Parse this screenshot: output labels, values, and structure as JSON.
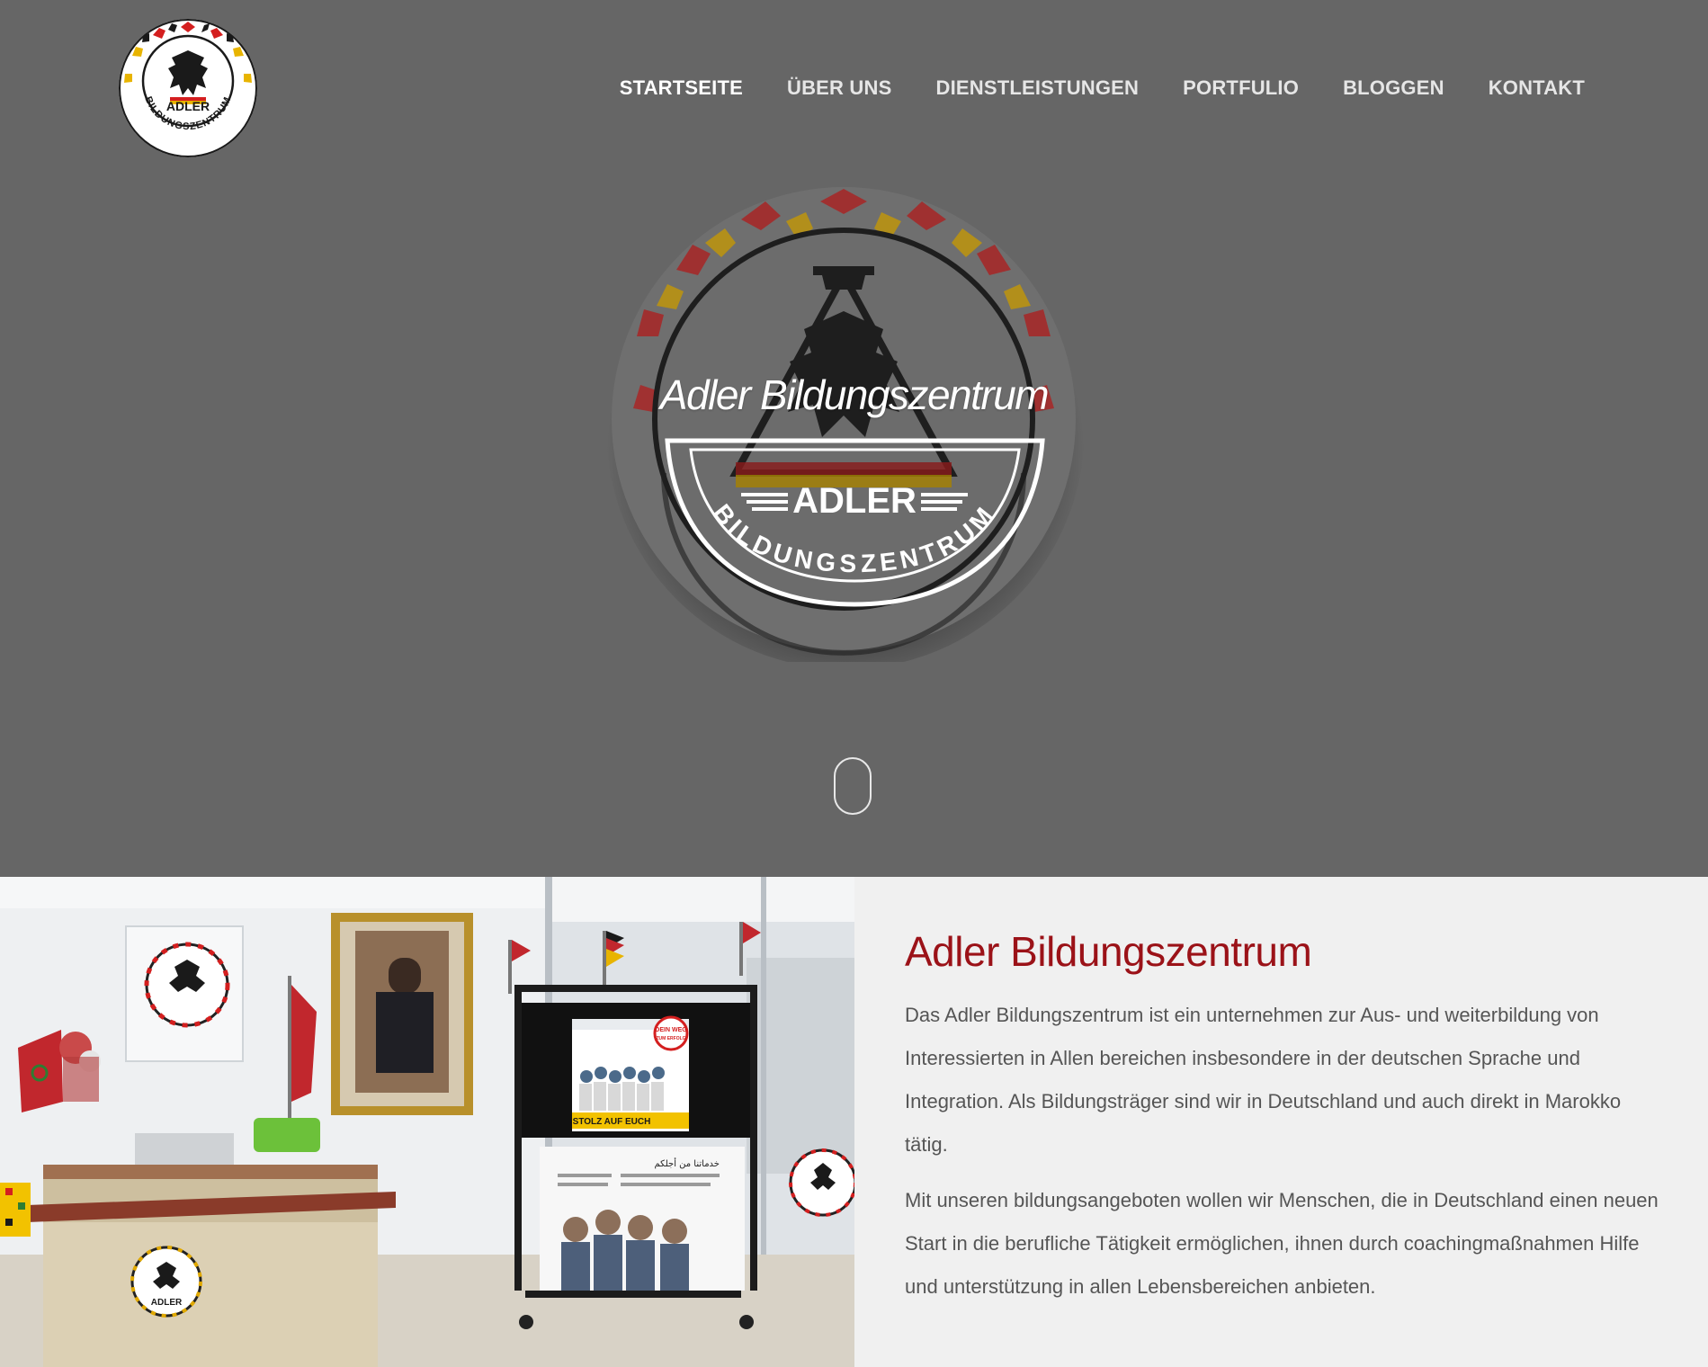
{
  "header": {
    "logo_alt": "Adler Bildungszentrum Logo",
    "logo_text_top": "ADLER",
    "logo_text_ring": "BILDUNGSZENTRUM"
  },
  "nav": {
    "items": [
      {
        "label": "STARTSEITE",
        "active": true
      },
      {
        "label": "ÜBER UNS",
        "active": false
      },
      {
        "label": "DIENSTLEISTUNGEN",
        "active": false
      },
      {
        "label": "PORTFULIO",
        "active": false
      },
      {
        "label": "BLOGGEN",
        "active": false
      },
      {
        "label": "KONTAKT",
        "active": false
      }
    ]
  },
  "hero": {
    "title": "Adler Bildungszentrum",
    "badge_top": "ADLER",
    "badge_ring": "BILDUNGSZENTRUM",
    "scroll_icon": "mouse-scroll-icon"
  },
  "about": {
    "heading": "Adler Bildungszentrum",
    "paragraph1": "Das Adler Bildungszentrum ist ein unternehmen zur Aus- und weiterbildung von Interessierten in Allen bereichen insbesondere in der deutschen Sprache und Integration. Als Bildungsträger sind wir in Deutschland und auch direkt in Marokko tätig.",
    "paragraph2": "Mit unseren bildungsangeboten wollen wir Menschen, die in Deutschland einen neuen Start in die berufliche Tätigkeit ermöglichen, ihnen durch coachingmaßnahmen Hilfe und unterstützung in allen Lebensbereichen anbieten.",
    "photo": {
      "screen_line1": "DEIN WEG",
      "screen_line2": "ZUM ERFOLG",
      "screen_banner": "STOLZ AUF EUCH",
      "poster_heading": "خدماتنا من أجلكم",
      "sign_text": "ADLER"
    }
  },
  "colors": {
    "hero_bg": "#666666",
    "heading_red": "#9b1218",
    "panel_bg": "#f0f0f0",
    "body_text": "#555555"
  }
}
